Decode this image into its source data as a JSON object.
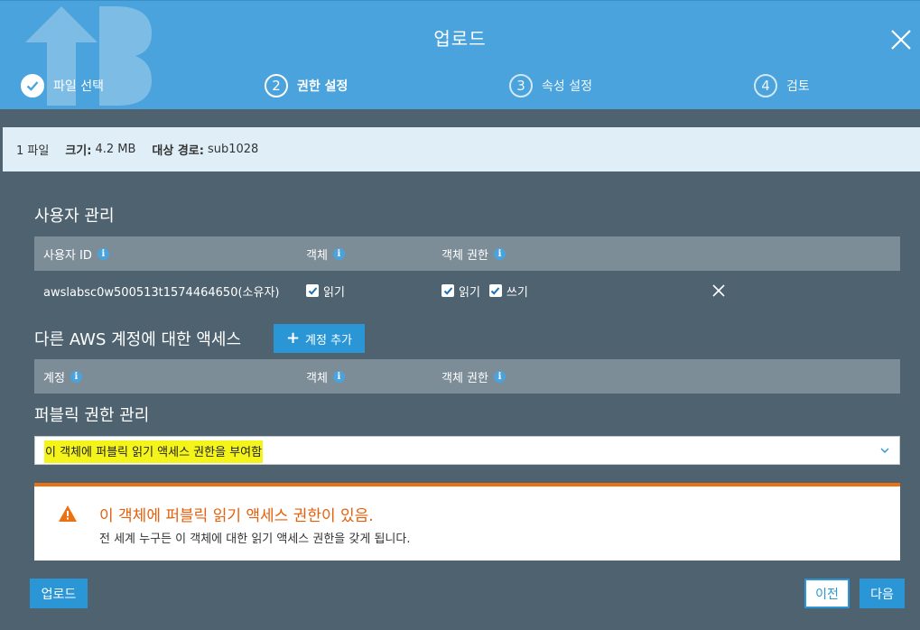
{
  "header": {
    "title": "업로드",
    "steps": [
      {
        "number": "1",
        "label": "파일 선택",
        "state": "completed"
      },
      {
        "number": "2",
        "label": "권한 설정",
        "state": "active"
      },
      {
        "number": "3",
        "label": "속성 설정",
        "state": "pending"
      },
      {
        "number": "4",
        "label": "검토",
        "state": "pending"
      }
    ]
  },
  "infobar": {
    "file_count": "1 파일",
    "size_label": "크기:",
    "size_value": "4.2 MB",
    "dest_label": "대상 경로:",
    "dest_value": "sub1028"
  },
  "user_management": {
    "title": "사용자 관리",
    "columns": [
      "사용자 ID",
      "객체",
      "객체 권한"
    ],
    "rows": [
      {
        "user_id": "awslabsc0w500513t1574464650(소유자)",
        "object": [
          {
            "label": "읽기",
            "checked": true
          }
        ],
        "object_permissions": [
          {
            "label": "읽기",
            "checked": true
          },
          {
            "label": "쓰기",
            "checked": true
          }
        ]
      }
    ]
  },
  "other_accounts": {
    "title": "다른 AWS 계정에 대한 액세스",
    "add_button": "계정 추가",
    "columns": [
      "계정",
      "객체",
      "객체 권한"
    ]
  },
  "public_permissions": {
    "title": "퍼블릭 권한 관리",
    "selected": "이 객체에 퍼블릭 읽기 액세스 권한을 부여함",
    "highlight_color": "#f4f41a"
  },
  "alert": {
    "title": "이 객체에 퍼블릭 읽기 액세스 권한이 있음.",
    "description": "전 세계 누구든 이 객체에 대한 읽기 액세스 권한을 갖게 됩니다.",
    "color": "#ec7211"
  },
  "footer": {
    "upload_button": "업로드",
    "prev_button": "이전",
    "next_button": "다음"
  },
  "colors": {
    "header": "#4aa3dc",
    "background": "#4f6270",
    "table_header": "#7d8d98",
    "primary_button": "#2a96d6"
  }
}
